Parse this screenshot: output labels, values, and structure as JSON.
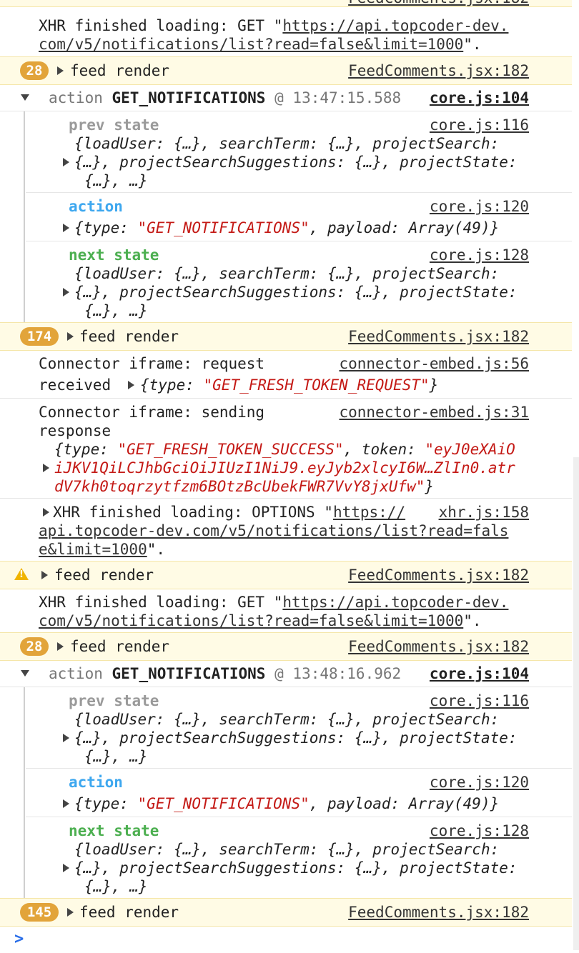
{
  "top_partial": {
    "label": "feed render",
    "src": "FeedComments.jsx:182"
  },
  "xhr1": {
    "prefix": "XHR finished loading: GET \"",
    "url_part1": "https://api.topcoder-dev.",
    "url_part2": "com/v5/notifications/list?read=false&limit=1000",
    "suffix": "\"."
  },
  "feed1": {
    "count": "28",
    "label": "feed render",
    "src": "FeedComments.jsx:182"
  },
  "action_group1": {
    "label": "action",
    "name": "GET_NOTIFICATIONS",
    "at": "@",
    "time": "13:47:15.588",
    "src": "core.js:104",
    "prev_label": "prev state",
    "prev_src": "core.js:116",
    "state_line1": "{loadUser: {…}, searchTerm: {…}, projectSearch:",
    "state_line2": "{…}, projectSearchSuggestions: {…}, projectState:",
    "state_line3": "{…}, …}",
    "action_label": "action",
    "action_src": "core.js:120",
    "action_obj_pre": "{type: ",
    "action_type": "\"GET_NOTIFICATIONS\"",
    "action_obj_post": ", payload: Array(49)}",
    "next_label": "next state",
    "next_src": "core.js:128"
  },
  "feed2": {
    "count": "174",
    "label": "feed render",
    "src": "FeedComments.jsx:182"
  },
  "connector1": {
    "line1": "Connector iframe: request",
    "line2": "received",
    "obj_pre": "{type: ",
    "obj_type": "\"GET_FRESH_TOKEN_REQUEST\"",
    "obj_post": "}",
    "src": "connector-embed.js:56"
  },
  "connector2": {
    "line1": "Connector iframe: sending",
    "line2": "response",
    "obj_pre": "{type: ",
    "obj_type": "\"GET_FRESH_TOKEN_SUCCESS\"",
    "obj_mid": ", token: ",
    "token1": "\"eyJ0eXAiO",
    "token2": "iJKV1QiLCJhbGciOiJIUzI1NiJ9.eyJyb2xlcyI6W…ZlIn0.atr",
    "token3": "dV7kh0toqrzytfzm6BOtzBcUbekFWR7VvY8jxUfw\"",
    "obj_post": "}",
    "src": "connector-embed.js:31"
  },
  "xhr_options": {
    "prefix": "XHR finished loading: OPTIONS \"",
    "url1": "https://",
    "url2": "api.topcoder-dev.com/v5/notifications/list?read=fals",
    "url3": "e&limit=1000",
    "suffix": "\".",
    "src": "xhr.js:158"
  },
  "warn_feed": {
    "label": "feed render",
    "src": "FeedComments.jsx:182"
  },
  "xhr2": {
    "prefix": "XHR finished loading: GET \"",
    "url_part1": "https://api.topcoder-dev.",
    "url_part2": "com/v5/notifications/list?read=false&limit=1000",
    "suffix": "\"."
  },
  "feed3": {
    "count": "28",
    "label": "feed render",
    "src": "FeedComments.jsx:182"
  },
  "action_group2": {
    "label": "action",
    "name": "GET_NOTIFICATIONS",
    "at": "@",
    "time": "13:48:16.962",
    "src": "core.js:104"
  },
  "feed4": {
    "count": "145",
    "label": "feed render",
    "src": "FeedComments.jsx:182"
  },
  "prompt": ">",
  "colors": {
    "badge": "#e2a43a",
    "warn_bg": "#fffbe5",
    "string": "#c41a16",
    "action": "#3da7ef",
    "next_state": "#4caf50",
    "prev_state": "#9a9a9a"
  }
}
